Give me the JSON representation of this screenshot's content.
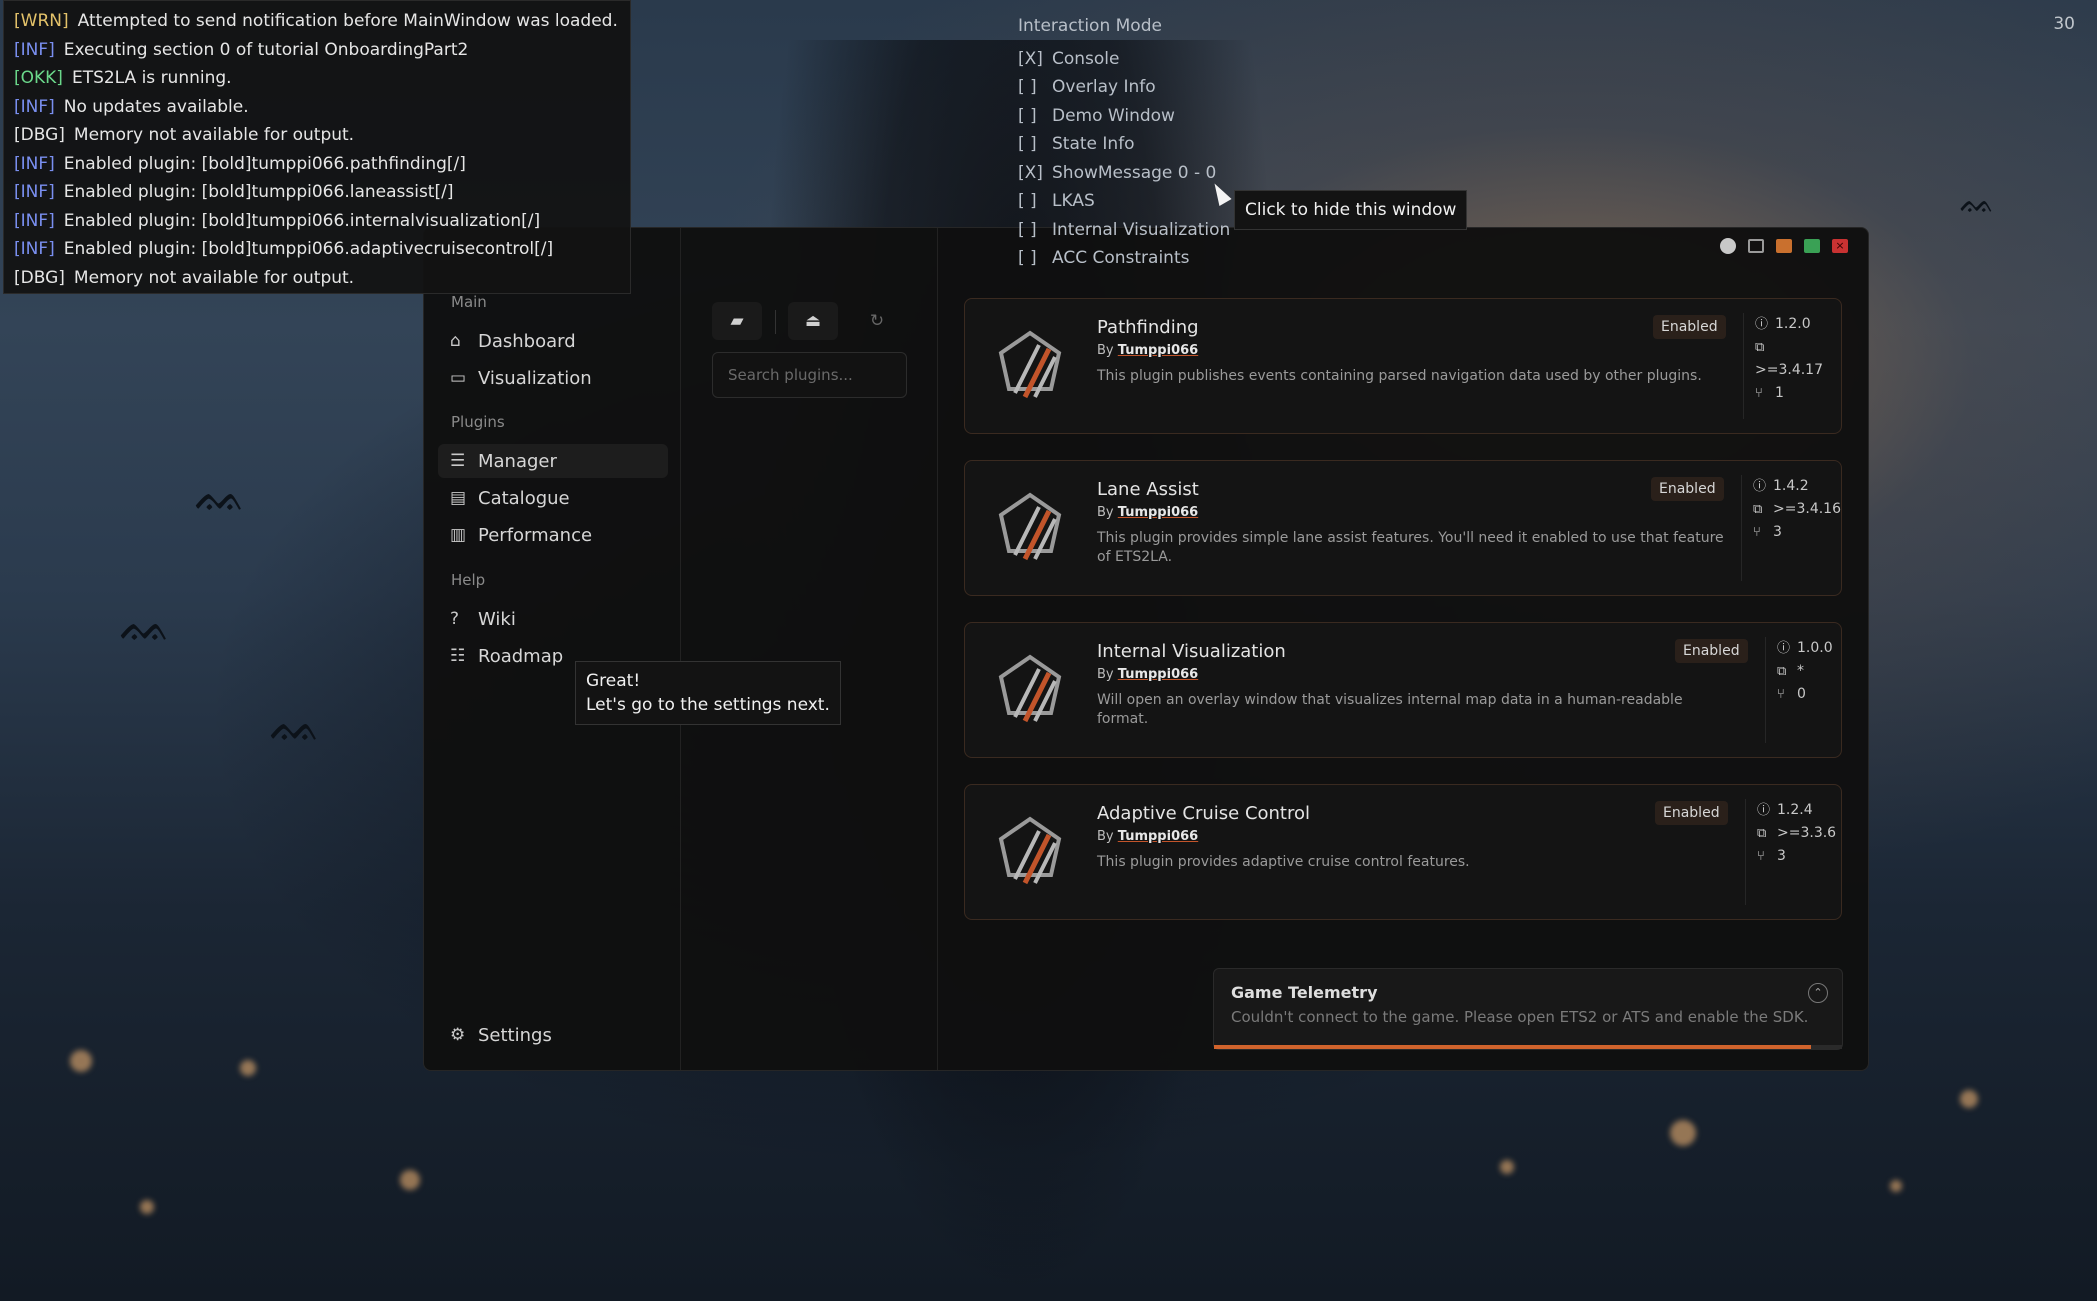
{
  "console": {
    "lines": [
      {
        "level": "[WRN]",
        "text": "Attempted to send notification before MainWindow was loaded."
      },
      {
        "level": "[INF]",
        "text": "Executing section 0 of tutorial OnboardingPart2"
      },
      {
        "level": "[OKK]",
        "text": "ETS2LA is running."
      },
      {
        "level": "[INF]",
        "text": "No updates available."
      },
      {
        "level": "[DBG]",
        "text": "Memory not available for output."
      },
      {
        "level": "[INF]",
        "text": "Enabled plugin: [bold]tumppi066.pathfinding[/]"
      },
      {
        "level": "[INF]",
        "text": "Enabled plugin: [bold]tumppi066.laneassist[/]"
      },
      {
        "level": "[INF]",
        "text": "Enabled plugin: [bold]tumppi066.internalvisualization[/]"
      },
      {
        "level": "[INF]",
        "text": "Enabled plugin: [bold]tumppi066.adaptivecruisecontrol[/]"
      },
      {
        "level": "[DBG]",
        "text": "Memory not available for output."
      }
    ]
  },
  "interaction_mode": {
    "title": "Interaction Mode",
    "options": [
      {
        "box": "[X]",
        "label": "Console"
      },
      {
        "box": "[ ]",
        "label": "Overlay Info"
      },
      {
        "box": "[ ]",
        "label": "Demo Window"
      },
      {
        "box": "[ ]",
        "label": "State Info"
      },
      {
        "box": "[X]",
        "label": "ShowMessage 0 - 0"
      },
      {
        "box": "[ ]",
        "label": "LKAS"
      },
      {
        "box": "[ ]",
        "label": "Internal Visualization"
      },
      {
        "box": "[ ]",
        "label": "ACC Constraints"
      }
    ]
  },
  "fps": "30",
  "tooltip_hide": "Click to hide this window",
  "sidebar": {
    "groups": {
      "main": "Main",
      "plugins": "Plugins",
      "help": "Help"
    },
    "items": {
      "dashboard": "Dashboard",
      "visualization": "Visualization",
      "manager": "Manager",
      "catalogue": "Catalogue",
      "performance": "Performance",
      "wiki": "Wiki",
      "roadmap": "Roadmap",
      "settings": "Settings"
    }
  },
  "search": {
    "placeholder": "Search plugins..."
  },
  "plugins": [
    {
      "name": "Pathfinding",
      "by": "By",
      "author": "Tumppi066",
      "desc": "This plugin publishes events containing parsed navigation data used by other plugins.",
      "status": "Enabled",
      "version": "1.2.0",
      "requires": ">=3.4.17",
      "forks": "1"
    },
    {
      "name": "Lane Assist",
      "by": "By",
      "author": "Tumppi066",
      "desc": "This plugin provides simple lane assist features. You'll need it enabled to use that feature of ETS2LA.",
      "status": "Enabled",
      "version": "1.4.2",
      "requires": ">=3.4.16",
      "forks": "3"
    },
    {
      "name": "Internal Visualization",
      "by": "By",
      "author": "Tumppi066",
      "desc": "Will open an overlay window that visualizes internal map data in a human-readable format.",
      "status": "Enabled",
      "version": "1.0.0",
      "requires": "*",
      "forks": "0"
    },
    {
      "name": "Adaptive Cruise Control",
      "by": "By",
      "author": "Tumppi066",
      "desc": "This plugin provides adaptive cruise control features.",
      "status": "Enabled",
      "version": "1.2.4",
      "requires": ">=3.3.6",
      "forks": "3"
    }
  ],
  "telemetry": {
    "title": "Game Telemetry",
    "message": "Couldn't connect to the game. Please open ETS2 or ATS and enable the SDK.",
    "progress_percent": 95
  },
  "tooltip_great": {
    "line1": "Great!",
    "line2": "Let's go to the settings next."
  },
  "colors": {
    "accent": "#d0632c",
    "info": "#7a8ff0",
    "warn": "#e3c26a",
    "ok": "#6ad78a"
  }
}
